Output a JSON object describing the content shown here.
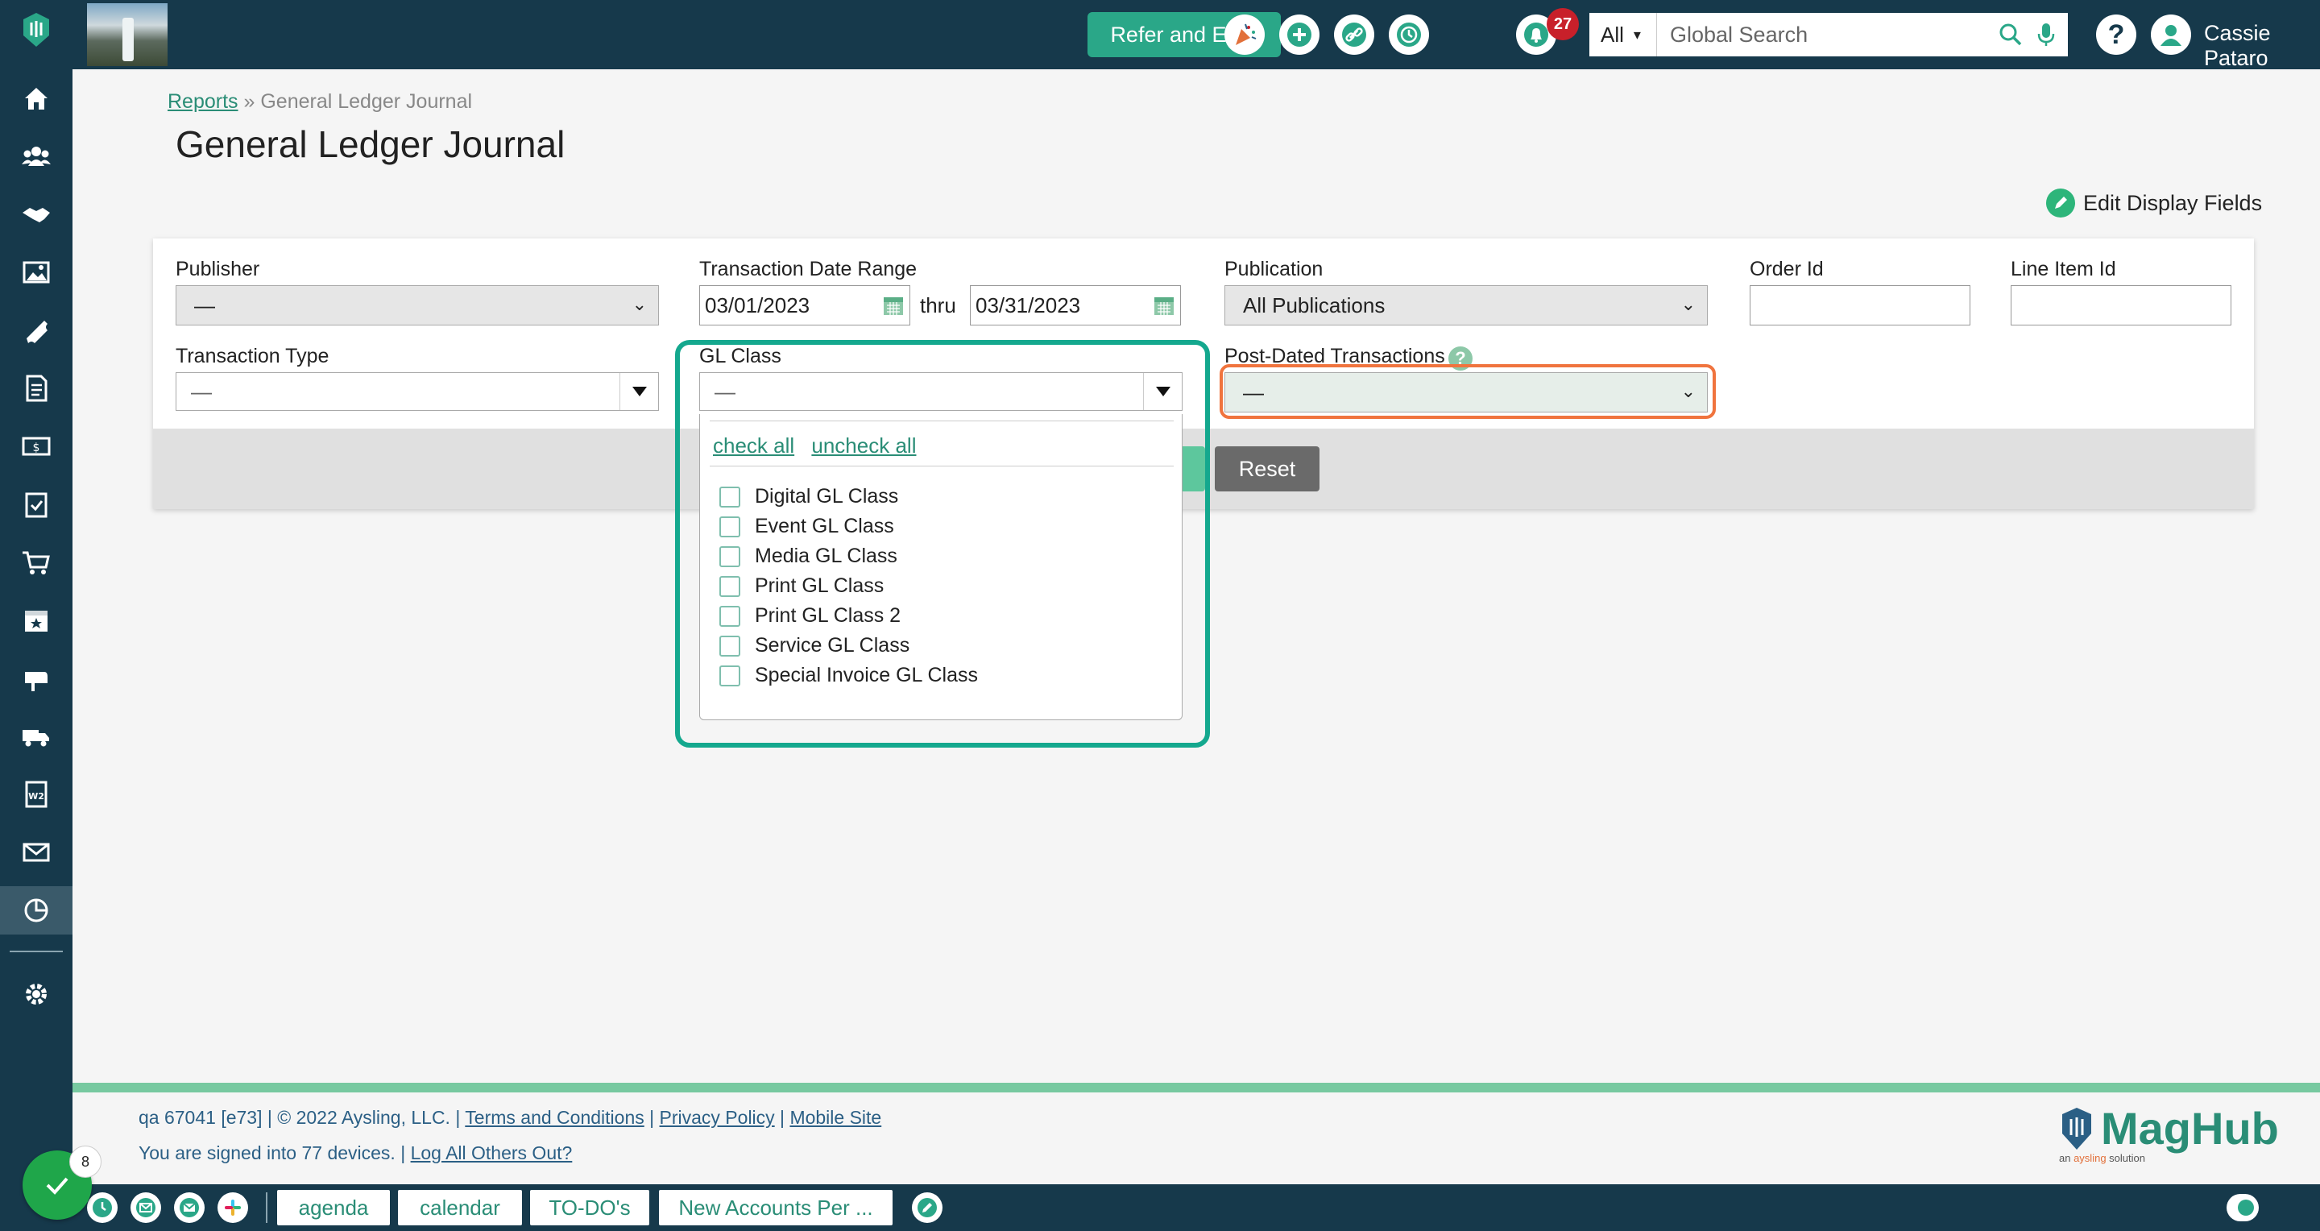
{
  "topbar": {
    "refer_label": "Refer and Earn",
    "notification_count": "27",
    "search_scope": "All",
    "search_placeholder": "Global Search",
    "user_name": "Cassie Pataro"
  },
  "sidebar": {
    "items": [
      "home",
      "contacts",
      "deals",
      "media",
      "tickets",
      "invoices",
      "billing",
      "tasks",
      "cart",
      "calendar",
      "mailbox",
      "delivery",
      "w2",
      "email",
      "reports",
      "settings"
    ],
    "active": "reports"
  },
  "breadcrumb": {
    "parent": "Reports",
    "separator": "»",
    "current": "General Ledger Journal"
  },
  "page": {
    "title": "General Ledger Journal",
    "edit_fields_label": "Edit Display Fields"
  },
  "filters": {
    "publisher": {
      "label": "Publisher",
      "value": "—"
    },
    "date_range": {
      "label": "Transaction Date Range",
      "from": "03/01/2023",
      "thru_label": "thru",
      "to": "03/31/2023"
    },
    "publication": {
      "label": "Publication",
      "value": "All Publications"
    },
    "order_id": {
      "label": "Order Id",
      "value": ""
    },
    "line_item_id": {
      "label": "Line Item Id",
      "value": ""
    },
    "transaction_type": {
      "label": "Transaction Type",
      "value": "—"
    },
    "gl_class": {
      "label": "GL Class",
      "value": "—",
      "check_all": "check all",
      "uncheck_all": "uncheck all",
      "options": [
        "Digital GL Class",
        "Event GL Class",
        "Media GL Class",
        "Print GL Class",
        "Print GL Class 2",
        "Service GL Class",
        "Special Invoice GL Class"
      ]
    },
    "post_dated": {
      "label": "Post-Dated Transactions",
      "value": "—"
    },
    "reset_label": "Reset"
  },
  "footer": {
    "version": "qa 67041 [e73] | © 2022 Aysling, LLC. |",
    "terms": "Terms and Conditions",
    "privacy": "Privacy Policy",
    "mobile": "Mobile Site",
    "devices_text": "You are signed into 77 devices. |",
    "logout_link": "Log All Others Out?",
    "brand": "MagHub",
    "brand_sub_prefix": "an ",
    "brand_sub_highlight": "aysling",
    "brand_sub_suffix": " solution"
  },
  "bottombar": {
    "tabs": [
      "agenda",
      "calendar",
      "TO-DO's",
      "New Accounts Per ..."
    ],
    "check_badge": "8"
  },
  "colors": {
    "navy": "#16394b",
    "accent": "#2aa788",
    "highlight_teal": "#14a88e",
    "highlight_orange": "#f0743e",
    "badge_red": "#c8202a"
  }
}
